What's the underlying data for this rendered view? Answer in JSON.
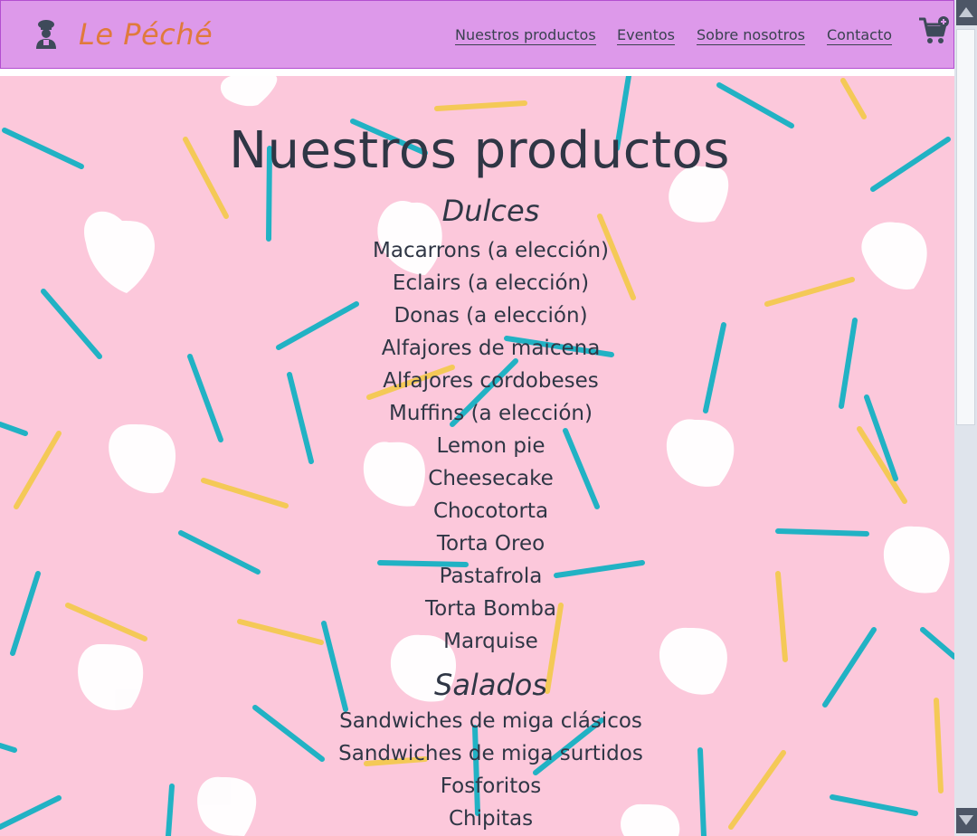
{
  "brand": {
    "name": "Le Péché",
    "logo_icon": "chef-icon",
    "brand_color": "#e07a3c"
  },
  "nav": {
    "links": [
      "Nuestros productos",
      "Eventos",
      "Sobre nosotros",
      "Contacto"
    ],
    "cart_icon": "cart-add-icon",
    "background": "#dd99ea"
  },
  "main": {
    "title": "Nuestros productos",
    "sections": [
      {
        "title": "Dulces",
        "items": [
          "Macarrons (a elección)",
          "Eclairs (a elección)",
          "Donas (a elección)",
          "Alfajores de maicena",
          "Alfajores cordobeses",
          "Muffins (a elección)",
          "Lemon pie",
          "Cheesecake",
          "Chocotorta",
          "Torta Oreo",
          "Pastafrola",
          "Torta Bomba",
          "Marquise"
        ]
      },
      {
        "title": "Salados",
        "items": [
          "Sandwiches de miga clásicos",
          "Sandwiches de miga surtidos",
          "Fosforitos",
          "Chipitas"
        ]
      }
    ],
    "background_color": "#fcc8db"
  }
}
